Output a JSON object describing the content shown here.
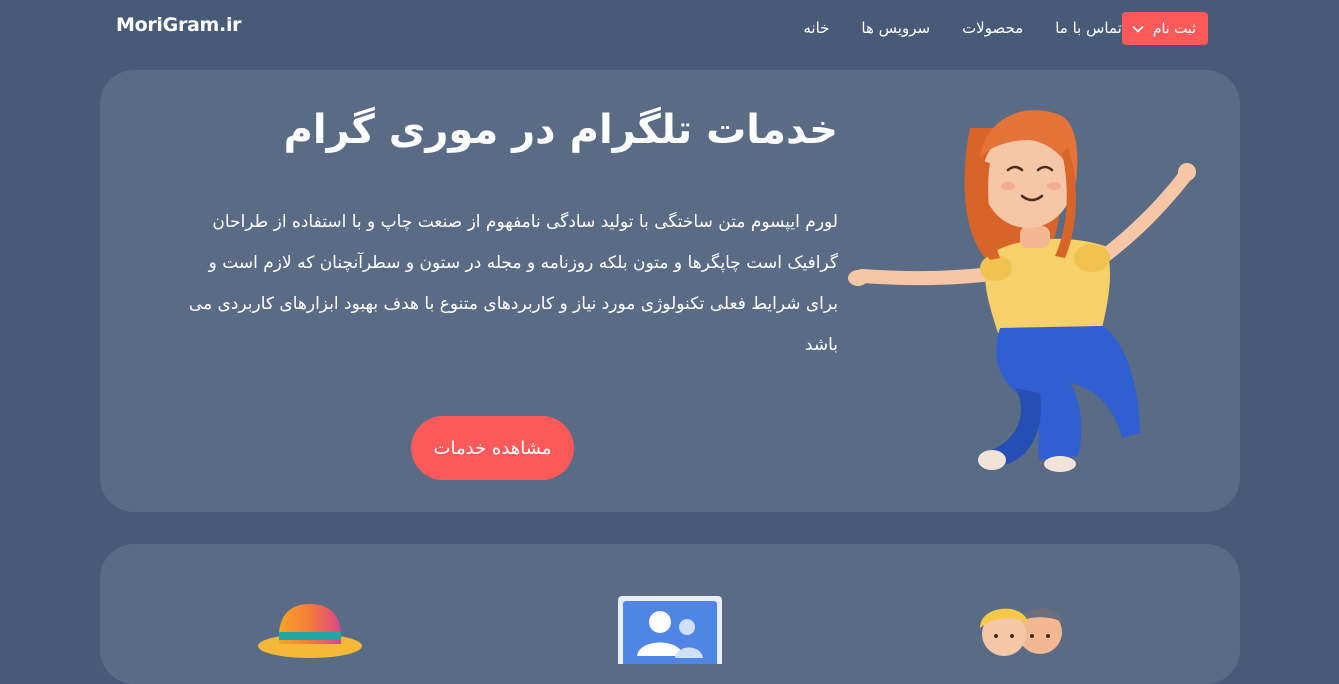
{
  "nav": {
    "brand": "MoriGram.ir",
    "links": [
      "خانه",
      "سرویس ها",
      "محصولات",
      "تماس با ما"
    ],
    "register_label": "ثبت نام"
  },
  "hero": {
    "title": "خدمات تلگرام در موری گرام",
    "description": "لورم ایپسوم متن ساختگی با تولید سادگی نامفهوم از صنعت چاپ و با استفاده از طراحان گرافیک است چاپگرها و متون بلکه روزنامه و مجله در ستون و سطرآنچنان که لازم است و برای شرایط فعلی تکنولوژی مورد نیاز و کاربردهای متنوع با هدف بهبود ابزارهای کاربردی می باشد",
    "cta_label": "مشاهده خدمات"
  },
  "services": {
    "icons": [
      "hat-icon",
      "contacts-icon",
      "friends-icon"
    ]
  },
  "colors": {
    "background": "#475a78",
    "card": "#5a6b86",
    "accent": "#fc5a5a"
  }
}
